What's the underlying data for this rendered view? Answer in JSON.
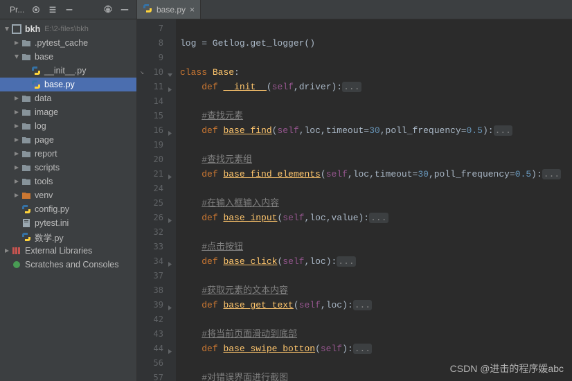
{
  "sidebar": {
    "title": "Pr...",
    "root": {
      "name": "bkh",
      "path": "E:\\2-files\\bkh"
    },
    "children": [
      {
        "label": ".pytest_cache",
        "type": "folder",
        "expanded": false
      },
      {
        "label": "base",
        "type": "folder",
        "expanded": true,
        "children": [
          {
            "label": "__init__.py",
            "type": "py"
          },
          {
            "label": "base.py",
            "type": "py",
            "selected": true
          }
        ]
      },
      {
        "label": "data",
        "type": "folder"
      },
      {
        "label": "image",
        "type": "folder"
      },
      {
        "label": "log",
        "type": "folder"
      },
      {
        "label": "page",
        "type": "folder"
      },
      {
        "label": "report",
        "type": "folder"
      },
      {
        "label": "scripts",
        "type": "folder"
      },
      {
        "label": "tools",
        "type": "folder"
      },
      {
        "label": "venv",
        "type": "venv"
      },
      {
        "label": "config.py",
        "type": "py"
      },
      {
        "label": "pytest.ini",
        "type": "ini"
      },
      {
        "label": "数学.py",
        "type": "py"
      }
    ],
    "external": "External Libraries",
    "scratches": "Scratches and Consoles"
  },
  "tab": {
    "label": "base.py"
  },
  "code": {
    "lines": [
      {
        "n": "7",
        "t": ""
      },
      {
        "n": "8",
        "t": "log = Getlog.get_logger()"
      },
      {
        "n": "9",
        "t": ""
      },
      {
        "n": "10",
        "t": "<kw>class</kw> <fn>Base</fn>:",
        "mark": "class",
        "fold": "down"
      },
      {
        "n": "11",
        "t": "    <kw>def</kw> <fnu>__init__</fnu>(<self>self</self>,driver):<dots>...</dots>",
        "fold": "right"
      },
      {
        "n": "14",
        "t": ""
      },
      {
        "n": "15",
        "t": "    <cmt>#查找元素</cmt>"
      },
      {
        "n": "16",
        "t": "    <kw>def</kw> <fnu>base_find</fnu>(<self>self</self>,loc,timeout=<num>30</num>,poll_frequency=<num>0.5</num>):<dots>...</dots>",
        "fold": "right"
      },
      {
        "n": "19",
        "t": ""
      },
      {
        "n": "20",
        "t": "    <cmt>#查找元素组</cmt>"
      },
      {
        "n": "21",
        "t": "    <kw>def</kw> <fnu>base_find_elements</fnu>(<self>self</self>,loc,timeout=<num>30</num>,poll_frequency=<num>0.5</num>):<dots>...</dots>",
        "fold": "right"
      },
      {
        "n": "24",
        "t": ""
      },
      {
        "n": "25",
        "t": "    <cmt>#在输入框输入内容</cmt>"
      },
      {
        "n": "26",
        "t": "    <kw>def</kw> <fnu>base_input</fnu>(<self>self</self>,loc,value):<dots>...</dots>",
        "fold": "right"
      },
      {
        "n": "32",
        "t": ""
      },
      {
        "n": "33",
        "t": "    <cmt>#点击按钮</cmt>"
      },
      {
        "n": "34",
        "t": "    <kw>def</kw> <fnu>base_click</fnu>(<self>self</self>,loc):<dots>...</dots>",
        "fold": "right"
      },
      {
        "n": "37",
        "t": ""
      },
      {
        "n": "38",
        "t": "    <cmt>#获取元素的文本内容</cmt>"
      },
      {
        "n": "39",
        "t": "    <kw>def</kw> <fnu>base_get_text</fnu>(<self>self</self>,loc):<dots>...</dots>",
        "fold": "right"
      },
      {
        "n": "42",
        "t": ""
      },
      {
        "n": "43",
        "t": "    <cmt>#将当前页面滑动到底部</cmt>"
      },
      {
        "n": "44",
        "t": "    <kw>def</kw> <fnu>base_swipe_botton</fnu>(<self>self</self>):<dots>...</dots>",
        "fold": "right"
      },
      {
        "n": "56",
        "t": ""
      },
      {
        "n": "57",
        "t": "    <cmt>#对错误界面进行截图</cmt>"
      }
    ]
  },
  "watermark": "CSDN @进击的程序媛abc"
}
